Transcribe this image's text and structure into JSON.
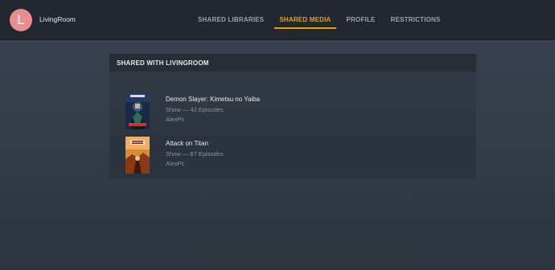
{
  "user": {
    "avatar_letter": "L",
    "name": "LivingRoom",
    "avatar_color": "#e88e8e"
  },
  "tabs": [
    {
      "label": "SHARED LIBRARIES",
      "active": false
    },
    {
      "label": "SHARED MEDIA",
      "active": true
    },
    {
      "label": "PROFILE",
      "active": false
    },
    {
      "label": "RESTRICTIONS",
      "active": false
    }
  ],
  "accent_color": "#e5a00d",
  "panel": {
    "heading": "SHARED WITH LIVINGROOM",
    "items": [
      {
        "title": "Demon Slayer: Kimetsu no Yaiba",
        "subtitle": "Show — 42 Episodes",
        "owner": "AlexPc",
        "poster_icon": "demon-slayer-poster"
      },
      {
        "title": "Attack on Titan",
        "subtitle": "Show — 87 Episodes",
        "owner": "AlexPc",
        "poster_icon": "attack-on-titan-poster"
      }
    ]
  }
}
